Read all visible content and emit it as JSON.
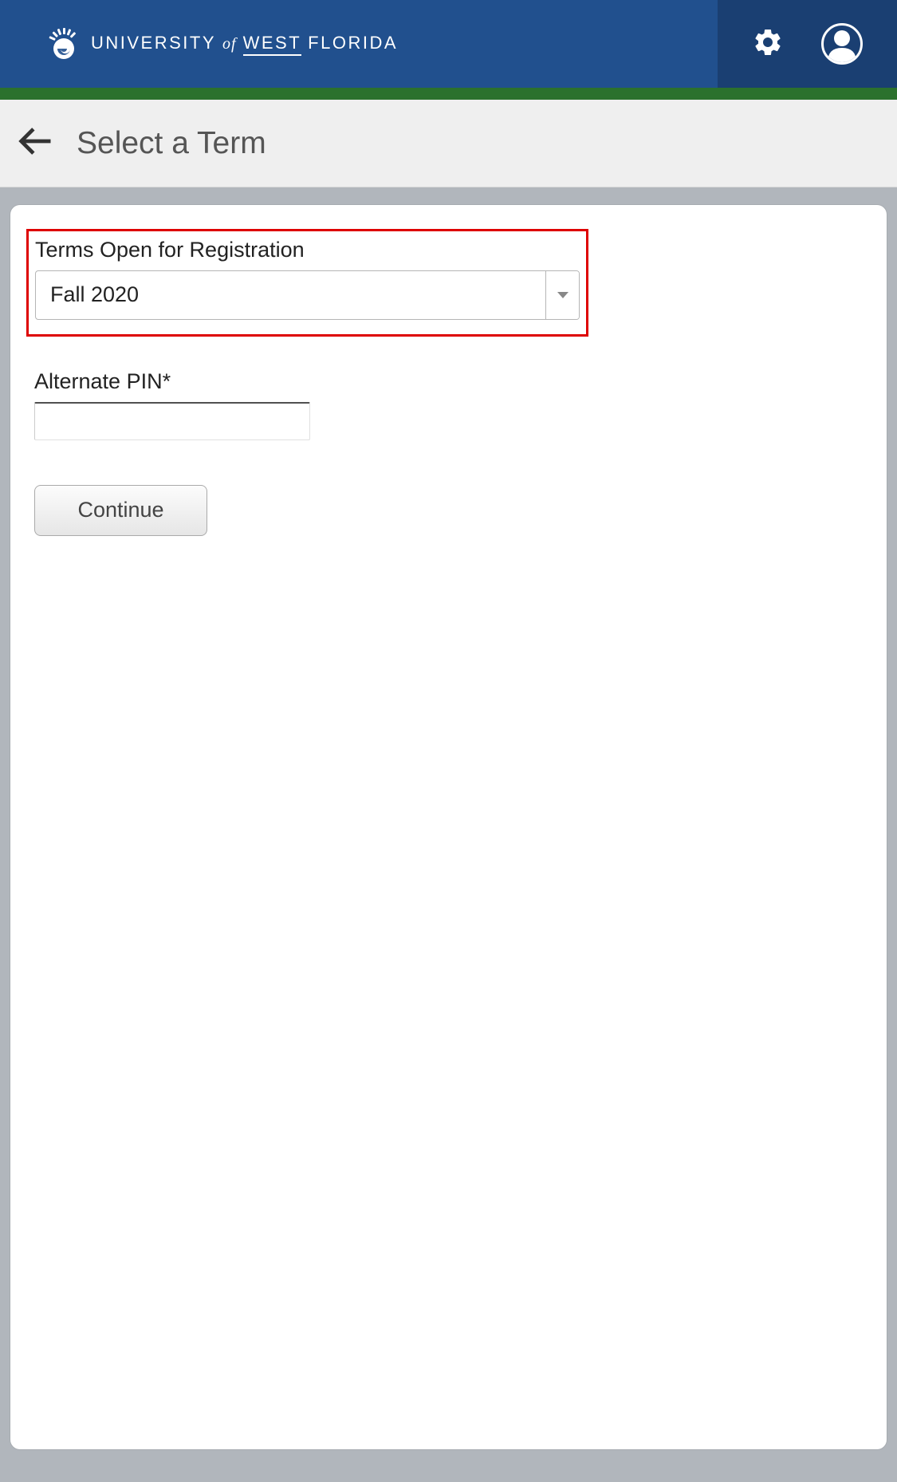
{
  "brand": {
    "word1": "UNIVERSITY",
    "word2": "of",
    "word3": "WEST",
    "word4": "FLORIDA"
  },
  "page": {
    "title": "Select a Term"
  },
  "form": {
    "terms_label": "Terms Open for Registration",
    "terms_selected": "Fall 2020",
    "pin_label": "Alternate PIN*",
    "pin_value": "",
    "continue_label": "Continue"
  }
}
